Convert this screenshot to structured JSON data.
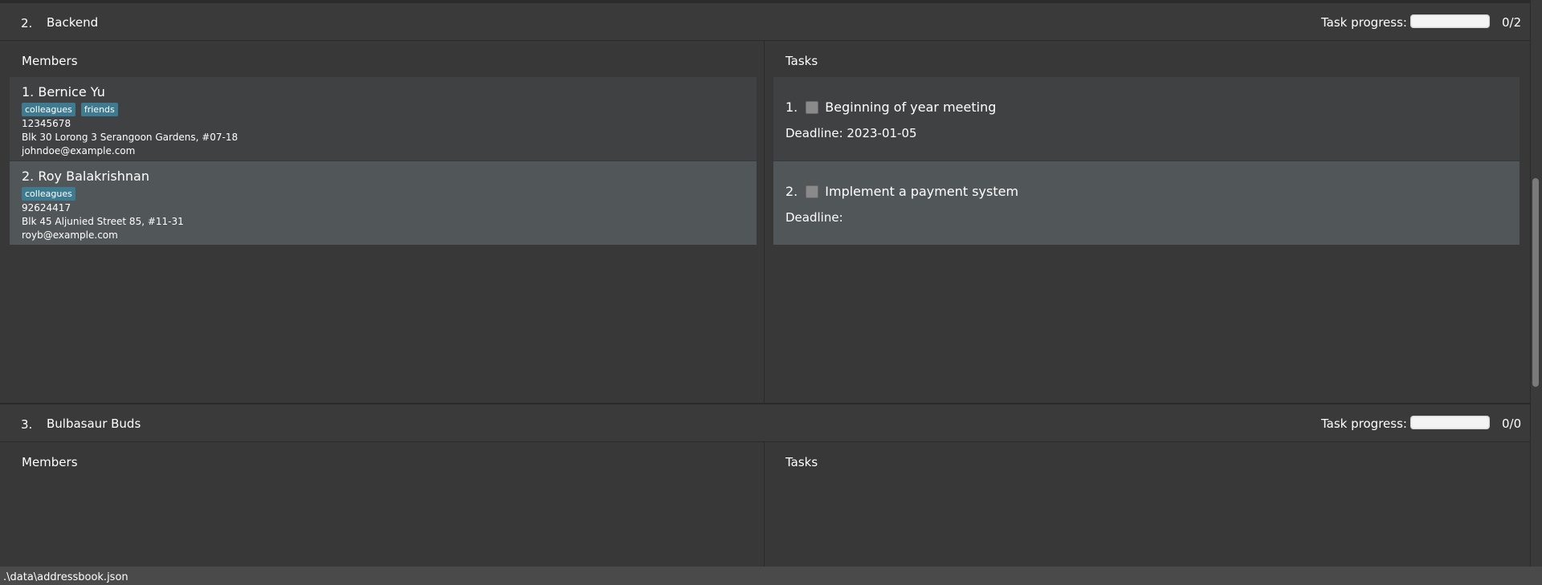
{
  "groups": [
    {
      "index": "2.",
      "name": "Backend",
      "progress_label": "Task progress:",
      "progress_fraction": 0.0,
      "progress_count": "0/2",
      "members_title": "Members",
      "tasks_title": "Tasks",
      "members": [
        {
          "name": "1.  Bernice Yu",
          "tags": [
            "colleagues",
            "friends"
          ],
          "phone": "12345678",
          "address": "Blk 30 Lorong 3 Serangoon Gardens, #07-18",
          "email": "johndoe@example.com"
        },
        {
          "name": "2.  Roy Balakrishnan",
          "tags": [
            "colleagues"
          ],
          "phone": "92624417",
          "address": "Blk 45 Aljunied Street 85, #11-31",
          "email": "royb@example.com"
        }
      ],
      "tasks": [
        {
          "index": "1.",
          "title": "Beginning of year meeting",
          "deadline": "Deadline:  2023-01-05"
        },
        {
          "index": "2.",
          "title": "Implement a payment system",
          "deadline": "Deadline:"
        }
      ]
    },
    {
      "index": "3.",
      "name": "Bulbasaur Buds",
      "progress_label": "Task progress:",
      "progress_fraction": 0.0,
      "progress_count": "0/0",
      "members_title": "Members",
      "tasks_title": "Tasks"
    }
  ],
  "statusbar": {
    "path": ".\\data\\addressbook.json"
  }
}
